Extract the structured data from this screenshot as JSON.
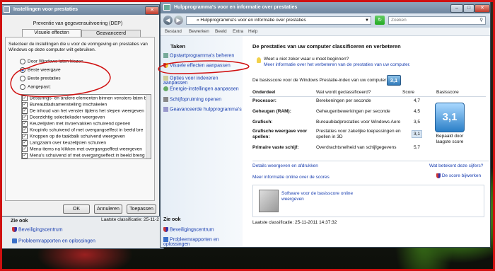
{
  "left_window": {
    "title": "Instellingen voor prestaties",
    "tab_dep": "Preventie van gegevensuitvoering (DEP)",
    "tab_visual": "Visuele effecten",
    "tab_advanced": "Geavanceerd",
    "intro": "Selecteer de instellingen die u voor de vormgeving en prestaties van Windows op deze computer wilt gebruiken.",
    "options": [
      "Door Windows laten kiezen",
      "Beste weergave",
      "Beste prestaties",
      "Aangepast:"
    ],
    "effects": [
      "Besturings- en andere elementen binnen vensters laten b",
      "Bureaubladsamenstelling inschakelen",
      "De inhoud van het venster tijdens het slepen weergeven",
      "Doorzichtig selectiekader weergeven",
      "Keuzelijsten met invoervakken schuivend openen",
      "Knopinfo schuivend of met overgangseffect in beeld bre",
      "Knoppen op de taakbalk schuivend weergeven",
      "Langzaam over keuzelijsten schuiven",
      "Menu-items na klikken met overgangseffect weergeven",
      "Menu's schuivend of met overgangseffect in beeld breng"
    ],
    "ok": "OK",
    "cancel": "Annuleren",
    "apply": "Toepassen"
  },
  "behind_window": {
    "last_rating": "Laatste classificatie: 25-11-2",
    "see_also": "Zie ook",
    "security": "Beveiligingscentrum",
    "problems": "Probleemrapporten en oplossingen"
  },
  "main_window": {
    "title": "Hulpprogramma's voor en informatie over prestaties",
    "address": "« Hulpprogramma's voor en informatie over prestaties",
    "search_placeholder": "Zoeken",
    "menu": [
      "Bestand",
      "Bewerken",
      "Beeld",
      "Extra",
      "Help"
    ],
    "tasks_title": "Taken",
    "tasks": [
      "Opstartprogramma's beheren",
      "Visuele effecten aanpassen",
      "Opties voor indexeren aanpassen",
      "Energie-instellingen aanpassen",
      "Schijfopruiming openen",
      "Geavanceerde hulpprogramma's"
    ],
    "see_also": "Zie ook",
    "security": "Beveiligingscentrum",
    "problems": "Probleemrapporten en oplossingen",
    "heading": "De prestaties van uw computer classificeren en verbeteren",
    "not_sure": "Weet u niet zeker waar u moet beginnen?",
    "more_info": "Meer informatie over het verbeteren van de prestaties van uw computer.",
    "base_text": "De basisscore voor de Windows Prestatie-index van uw computer is",
    "base_value": "3,1",
    "columns": [
      "Onderdeel",
      "Wat wordt geclassificeerd?",
      "Score",
      "Basisscore"
    ],
    "rows": [
      {
        "part": "Processor:",
        "what": "Berekeningen per seconde",
        "score": "4,7"
      },
      {
        "part": "Geheugen (RAM):",
        "what": "Geheugenbewerkingen per seconde",
        "score": "4,5"
      },
      {
        "part": "Grafisch:",
        "what": "Bureaubladprestaties voor Windows Aero",
        "score": "3,5"
      },
      {
        "part": "Grafische weergave voor spellen:",
        "what": "Prestaties voor zakelijke toepassingen en spellen in 3D",
        "score": "3,1"
      },
      {
        "part": "Primaire vaste schijf:",
        "what": "Overdrachtsnelheid van schijfgegevens",
        "score": "5,7"
      }
    ],
    "badge_value": "3,1",
    "badge_caption": "Bepaald door laagste score",
    "details_link": "Details weergeven en afdrukken",
    "what_mean": "Wat betekent deze cijfers?",
    "more_scores": "Meer informatie online over de scores",
    "update_score": "De score bijwerken",
    "software_link": "Software voor de basisscore online weergeven",
    "last_rating": "Laatste classificatie: 25-11-2011 14:37:32"
  }
}
